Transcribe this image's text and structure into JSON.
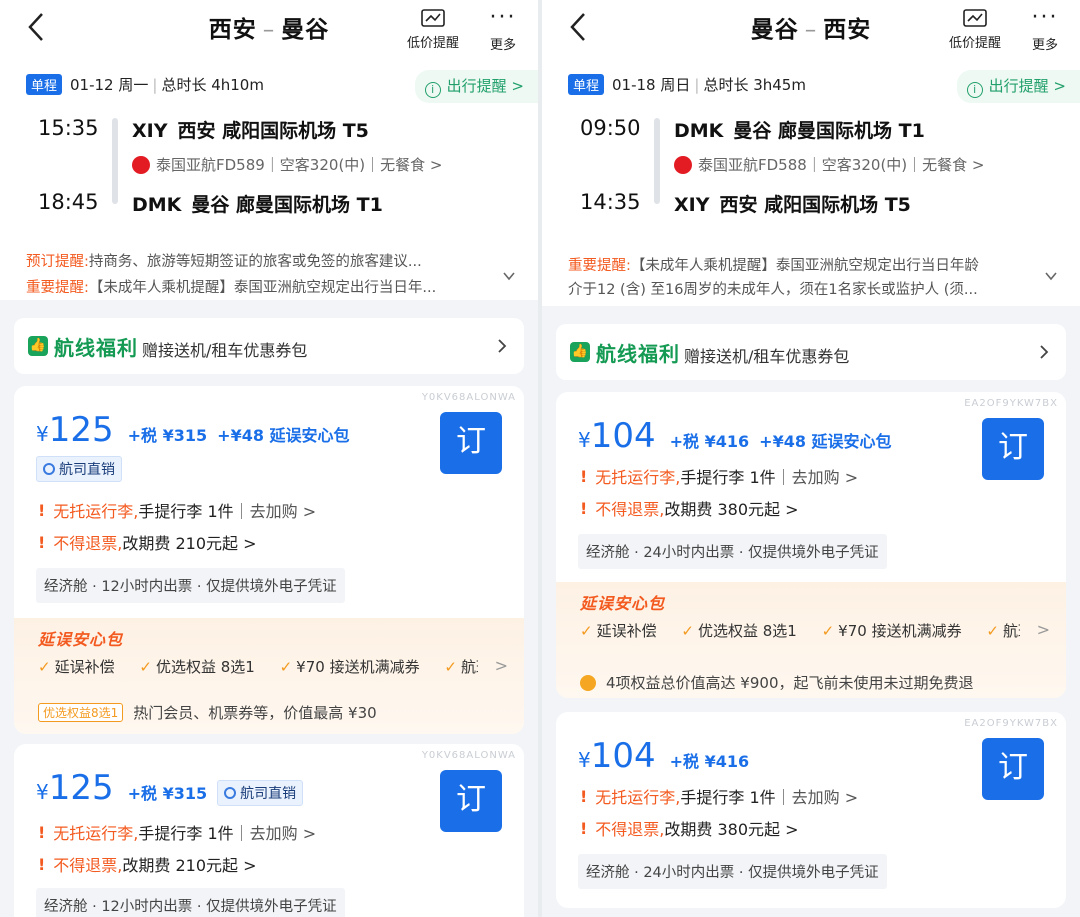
{
  "left": {
    "header": {
      "origin": "西安",
      "dash": "–",
      "dest": "曼谷",
      "price_alert_label": "低价提醒",
      "more_label": "更多"
    },
    "trip": {
      "type": "单程",
      "date": "01-12 周一",
      "duration": "总时长 4h10m",
      "reminder": "出行提醒 >"
    },
    "flight": {
      "dep_time": "15:35",
      "dep_code": "XIY",
      "dep_airport": "西安 咸阳国际机场 T5",
      "arr_time": "18:45",
      "arr_code": "DMK",
      "arr_airport": "曼谷 廊曼国际机场 T1",
      "info": "泰国亚航FD589｜空客320(中)｜无餐食 >"
    },
    "notices": [
      {
        "label": "预订提醒:",
        "text": "持商务、旅游等短期签证的旅客或免签的旅客建议..."
      },
      {
        "label": "重要提醒:",
        "text": "【未成年人乘机提醒】泰国亚洲航空规定出行当日年..."
      }
    ],
    "perk": {
      "icon": "👍",
      "title": "航线福利",
      "text": "赠接送机/租车优惠券包"
    },
    "cards": [
      {
        "code": "Y0KV68ALONWA",
        "yen": "¥",
        "price": "125",
        "tax": "+税 ¥315",
        "addon": "+¥48 延误安心包",
        "direct": "航司直销",
        "book": "订",
        "rule1_hl": "无托运行李,",
        "rule1_text": "手提行李 1件",
        "rule1_link": "｜去加购 >",
        "rule2_hl": "不得退票,",
        "rule2_text": "改期费 210元起 >",
        "info": "经济舱 · 12小时内出票 · 仅提供境外电子凭证",
        "delay_title": "延误安心包",
        "delay_items": [
          "延误补偿",
          "优选权益 8选1",
          "¥70 接送机满减券",
          "航班"
        ],
        "gift_badge": "优选权益8选1",
        "gift_text": "热门会员、机票券等，价值最高 ¥30"
      },
      {
        "code": "Y0KV68ALONWA",
        "yen": "¥",
        "price": "125",
        "tax": "+税 ¥315",
        "direct": "航司直销",
        "book": "订",
        "rule1_hl": "无托运行李,",
        "rule1_text": "手提行李 1件",
        "rule1_link": "｜去加购 >",
        "rule2_hl": "不得退票,",
        "rule2_text": "改期费 210元起 >",
        "info": "经济舱 · 12小时内出票 · 仅提供境外电子凭证"
      }
    ]
  },
  "right": {
    "header": {
      "origin": "曼谷",
      "dash": "–",
      "dest": "西安",
      "price_alert_label": "低价提醒",
      "more_label": "更多"
    },
    "trip": {
      "type": "单程",
      "date": "01-18 周日",
      "duration": "总时长 3h45m",
      "reminder": "出行提醒 >"
    },
    "flight": {
      "dep_time": "09:50",
      "dep_code": "DMK",
      "dep_airport": "曼谷 廊曼国际机场 T1",
      "arr_time": "14:35",
      "arr_code": "XIY",
      "arr_airport": "西安 咸阳国际机场 T5",
      "info": "泰国亚航FD588｜空客320(中)｜无餐食 >"
    },
    "notices": [
      {
        "label": "重要提醒:",
        "text": "【未成年人乘机提醒】泰国亚洲航空规定出行当日年龄"
      },
      {
        "label": "",
        "text": "介于12 (含) 至16周岁的未成年人，须在1名家长或监护人 (须..."
      }
    ],
    "perk": {
      "icon": "👍",
      "title": "航线福利",
      "text": "赠接送机/租车优惠券包"
    },
    "cards": [
      {
        "code": "EA2OF9YKW7BX",
        "yen": "¥",
        "price": "104",
        "tax": "+税 ¥416",
        "addon": "+¥48 延误安心包",
        "book": "订",
        "rule1_hl": "无托运行李,",
        "rule1_text": "手提行李 1件",
        "rule1_link": "｜去加购 >",
        "rule2_hl": "不得退票,",
        "rule2_text": "改期费 380元起 >",
        "info": "经济舱 · 24小时内出票 · 仅提供境外电子凭证",
        "delay_title": "延误安心包",
        "delay_items": [
          "延误补偿",
          "优选权益 8选1",
          "¥70 接送机满减券",
          "航班"
        ],
        "gift_text": "4项权益总价值高达 ¥900，起飞前未使用未过期免费退"
      },
      {
        "code": "EA2OF9YKW7BX",
        "yen": "¥",
        "price": "104",
        "tax": "+税 ¥416",
        "book": "订",
        "rule1_hl": "无托运行李,",
        "rule1_text": "手提行李 1件",
        "rule1_link": "｜去加购 >",
        "rule2_hl": "不得退票,",
        "rule2_text": "改期费 380元起 >",
        "info": "经济舱 · 24小时内出票 · 仅提供境外电子凭证"
      }
    ]
  }
}
